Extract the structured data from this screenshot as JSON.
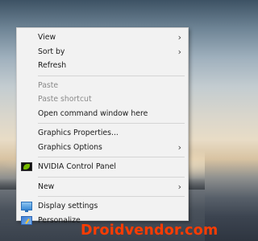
{
  "menu": {
    "view": "View",
    "sort_by": "Sort by",
    "refresh": "Refresh",
    "paste": "Paste",
    "paste_shortcut": "Paste shortcut",
    "open_cmd": "Open command window here",
    "graphics_properties": "Graphics Properties...",
    "graphics_options": "Graphics Options",
    "nvidia": "NVIDIA Control Panel",
    "new": "New",
    "display_settings": "Display settings",
    "personalize": "Personalize"
  },
  "icons": {
    "nvidia": "nvidia-logo-icon",
    "display": "display-icon",
    "personalize": "personalize-icon",
    "submenu": "chevron-right-icon"
  },
  "watermark": "Droidvendor.com",
  "colors": {
    "menu_bg": "#f2f2f2",
    "disabled_text": "#8a8a8a",
    "watermark": "#ff3c00",
    "nvidia_green": "#76b900"
  }
}
